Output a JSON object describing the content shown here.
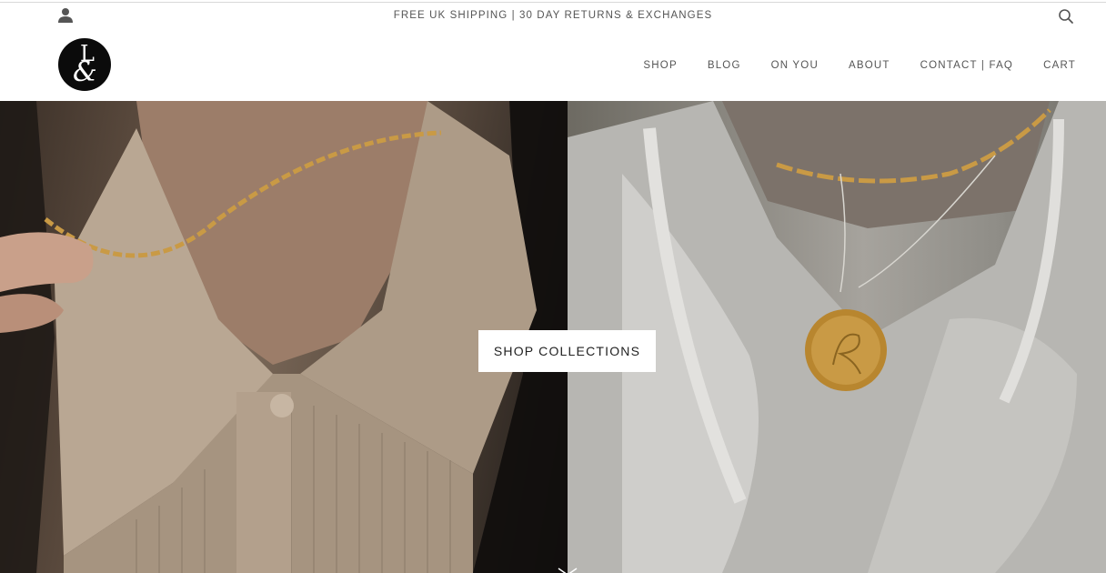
{
  "header": {
    "announcement": "FREE UK SHIPPING | 30 DAY RETURNS & EXCHANGES",
    "logo": {
      "letters": [
        "L",
        "&"
      ]
    },
    "icons": {
      "account": "account-icon",
      "search": "search-icon"
    }
  },
  "nav": {
    "items": [
      {
        "label": "SHOP"
      },
      {
        "label": "BLOG"
      },
      {
        "label": "ON YOU"
      },
      {
        "label": "ABOUT"
      },
      {
        "label": "CONTACT | FAQ"
      },
      {
        "label": "CART"
      }
    ]
  },
  "hero": {
    "cta_label": "SHOP COLLECTIONS",
    "left_image": "model-wearing-gold-figaro-chain-and-beige-polo",
    "right_image": "model-wearing-gold-engraved-pendant-and-white-hoodie",
    "scroll_icon": "chevron-down-icon"
  },
  "colors": {
    "background": "#ffffff",
    "text": "#555555",
    "logo_bg": "#0b0b0b",
    "cta_bg": "#ffffff",
    "gold": "#c99a45"
  }
}
